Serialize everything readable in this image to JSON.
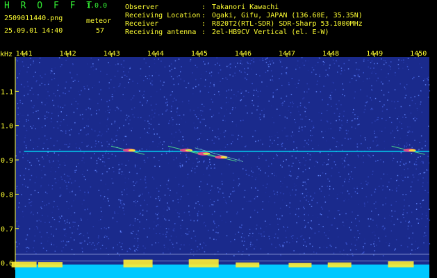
{
  "app": {
    "title": "H R O F F T",
    "version": "1.0.0"
  },
  "file": {
    "name": "2509011440.png",
    "datetime": "25.09.01 14:40"
  },
  "meteor": {
    "label": "meteor",
    "count": "57"
  },
  "info": [
    {
      "label": "Observer",
      "value": "Takanori Kawachi"
    },
    {
      "label": "Receiving Location",
      "value": "Ogaki, Gifu, JAPAN (136.60E, 35.35N)"
    },
    {
      "label": "Receiver",
      "value": "R820T2(RTL-SDR) SDR-Sharp 53.1000MHz"
    },
    {
      "label": "Receiving antenna",
      "value": "2el-HB9CV Vertical (el. E-W)"
    }
  ],
  "colors": {
    "background": "#000000",
    "plot_background": "#1a2a8c",
    "text": "#ffff33",
    "title": "#33ee33",
    "signal": "#00e5ff",
    "bottom_band": "#00c8ff"
  },
  "chart_data": {
    "type": "heatmap",
    "x": {
      "label": "",
      "ticks": [
        "1441",
        "1442",
        "1443",
        "1444",
        "1445",
        "1446",
        "1447",
        "1448",
        "1449",
        "1450"
      ],
      "range": [
        1440.8,
        1450.25
      ]
    },
    "y": {
      "label": "kHz",
      "ticks": [
        "1.1",
        "1.0",
        "0.9",
        "0.8",
        "0.7",
        "0.6"
      ],
      "range": [
        0.58,
        1.2
      ]
    },
    "carrier": {
      "frequency_khz": 0.925,
      "start_x": 1441.0,
      "end_x": 1450.25
    },
    "meteor_echoes": [
      {
        "x_center": 1443.4,
        "freq_khz": 0.93
      },
      {
        "x_center": 1444.7,
        "freq_khz": 0.93
      },
      {
        "x_center": 1445.1,
        "freq_khz": 0.92
      },
      {
        "x_center": 1445.5,
        "freq_khz": 0.91
      },
      {
        "x_center": 1449.8,
        "freq_khz": 0.93
      }
    ],
    "bottom_activity": [
      {
        "x_center": 1441.0,
        "strength": 0.4
      },
      {
        "x_center": 1441.6,
        "strength": 0.35
      },
      {
        "x_center": 1443.6,
        "strength": 0.7
      },
      {
        "x_center": 1445.1,
        "strength": 0.75
      },
      {
        "x_center": 1446.1,
        "strength": 0.3
      },
      {
        "x_center": 1447.3,
        "strength": 0.25
      },
      {
        "x_center": 1448.2,
        "strength": 0.3
      },
      {
        "x_center": 1449.6,
        "strength": 0.45
      }
    ],
    "grid": true
  }
}
